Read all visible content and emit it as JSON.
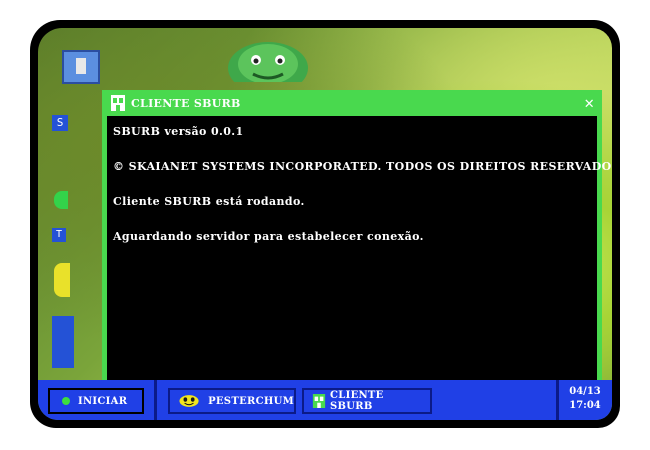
{
  "window": {
    "title": "CLIENTE SBURB",
    "close_label": "✕",
    "lines": [
      "SBURB versão 0.0.1",
      "© SKAIANET SYSTEMS INCORPORATED. TODOS OS DIREITOS RESERVADOS.",
      "Cliente SBURB está rodando.",
      "Aguardando servidor para estabelecer conexão."
    ]
  },
  "desktop": {
    "icon_s_letter": "S",
    "icon_t_letter": "T"
  },
  "taskbar": {
    "start_label": "INICIAR",
    "pesterchum_label": "PESTERCHUM",
    "sburb_label": "CLIENTE SBURB",
    "clock_date": "04/13",
    "clock_time": "17:04"
  },
  "colors": {
    "window_frame": "#49d94e",
    "taskbar": "#2040e6",
    "terminal_bg": "#000000",
    "start_dot": "#3ddd3f"
  },
  "icons": [
    "sburb-house-icon",
    "close-icon",
    "start-dot-icon",
    "pesterchum-icon"
  ]
}
